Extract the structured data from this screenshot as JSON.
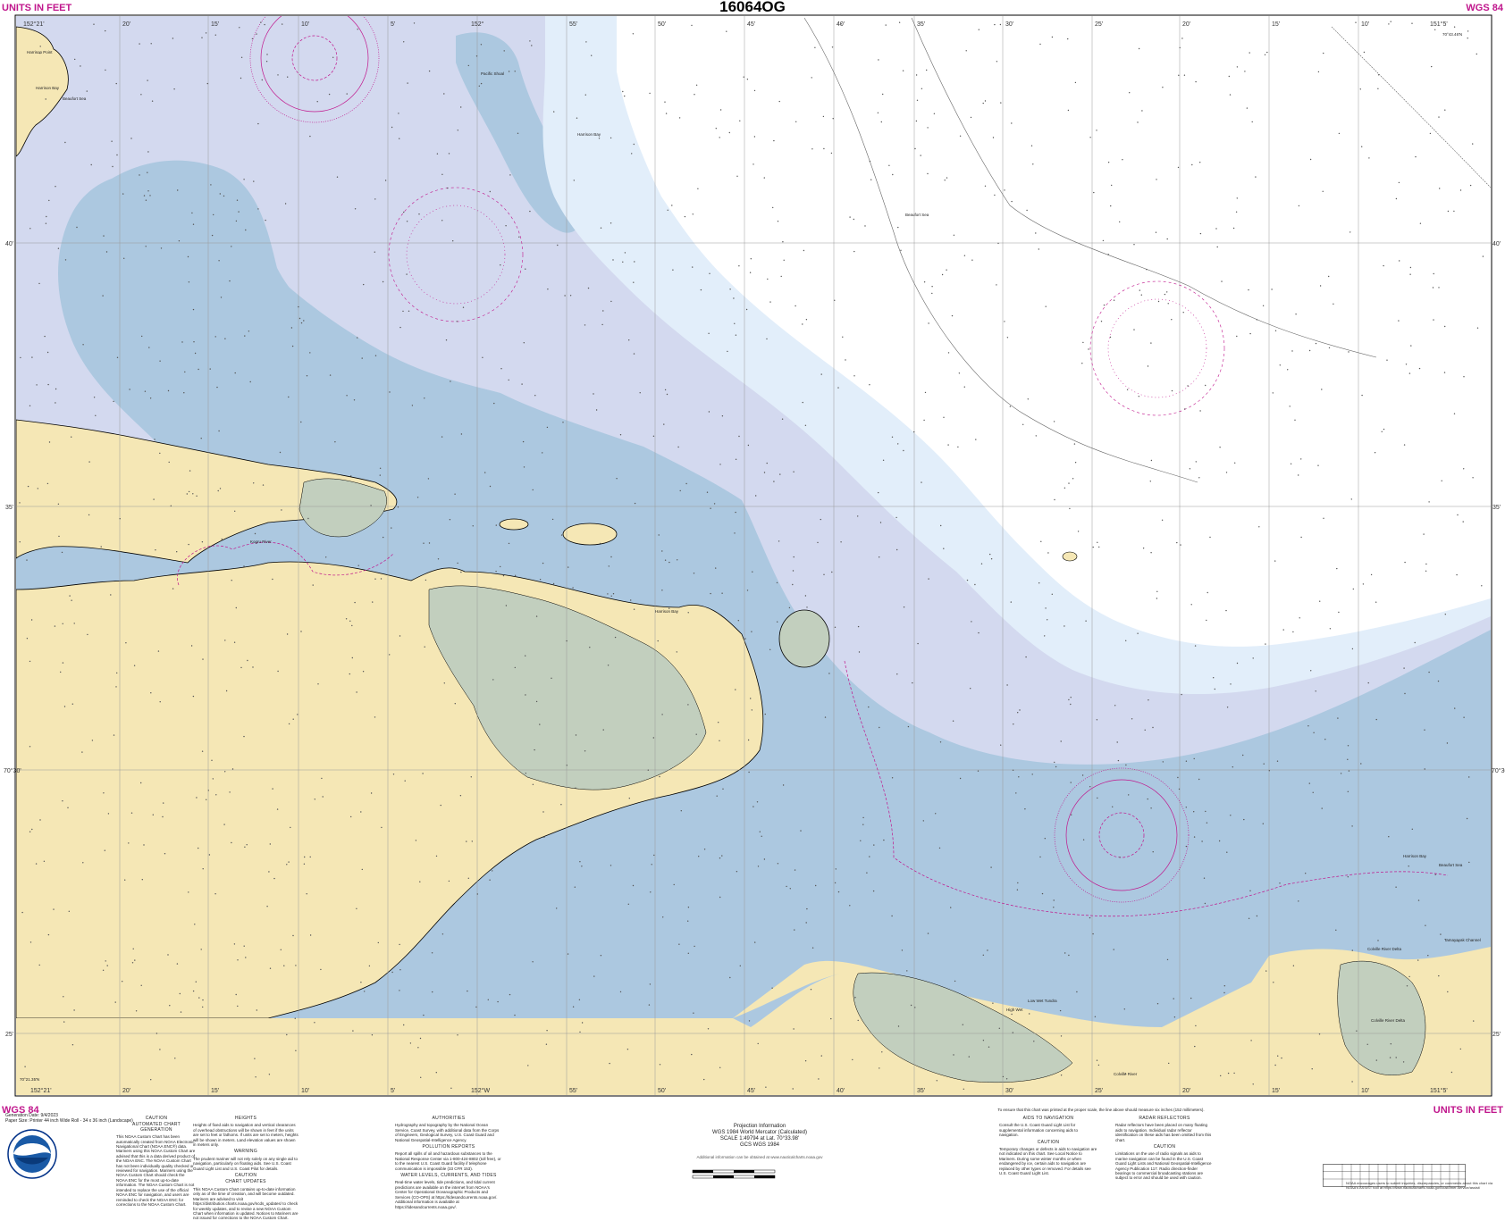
{
  "header": {
    "chart_number": "16064OG",
    "units_left": "UNITS IN FEET",
    "datum_right": "WGS 84"
  },
  "footer": {
    "datum_left": "WGS 84",
    "units_right": "UNITS IN FEET",
    "generation_label": "Generation Date: 9/4/2023",
    "paper_size": "Paper Size: Printer 44 inch Wide Roll - 34 x 36 inch (Landscape)"
  },
  "graticule": {
    "top_labels": [
      "152°21'",
      "20'",
      "15'",
      "10'",
      "5'",
      "152°",
      "55'",
      "50'",
      "45'",
      "40'",
      "35'",
      "30'",
      "25'",
      "20'",
      "15'",
      "10'",
      "151°5'"
    ],
    "bottom_labels": [
      "152°21'",
      "20'",
      "15'",
      "10'",
      "5'",
      "152°W",
      "55'",
      "50'",
      "45'",
      "40'",
      "35'",
      "30'",
      "25'",
      "20'",
      "15'",
      "10'",
      "151°5'"
    ],
    "left_labels": [
      "40'",
      "35'",
      "70°30'",
      "25'"
    ],
    "right_labels": [
      "40'",
      "35'",
      "70°30'",
      "25'"
    ],
    "corner_tr": "70°43.46'N",
    "corner_bl": "70°21.35'N"
  },
  "places": [
    {
      "name": "Harrison Point"
    },
    {
      "name": "Harrison Bay"
    },
    {
      "name": "Beaufort Sea"
    },
    {
      "name": "Pacific Shoal"
    },
    {
      "name": "Harrison Bay"
    },
    {
      "name": "Beaufort Sea"
    },
    {
      "name": "Kogru River"
    },
    {
      "name": "Harrison Bay"
    },
    {
      "name": "Harrison Bay"
    },
    {
      "name": "Beaufort Sea"
    },
    {
      "name": "Colville River Delta"
    },
    {
      "name": "Tamayayak Channel"
    },
    {
      "name": "Colville River Delta"
    },
    {
      "name": "Low Wet Tundra"
    },
    {
      "name": "Colville River"
    },
    {
      "name": "High Wet"
    }
  ],
  "notes": {
    "caution_auto": {
      "title": "CAUTION",
      "subtitle": "AUTOMATED CHART GENERATION",
      "text": "This NOAA Custom Chart has been automatically created from NOAA Electronic Navigational Chart (NOAA ENC®) data. Mariners using this NOAA Custom Chart are advised that this is a data derived product of the NOAA ENC. The NOAA Custom Chart has not been individually quality checked or reviewed for navigation. Mariners using the NOAA Custom Chart should check the NOAA ENC for the most up-to-date information. The NOAA Custom Chart is not intended to replace the use of the official NOAA ENC for navigation, and users are reminded to check the NOAA ENC for corrections to the NOAA Custom Chart."
    },
    "heights": {
      "title": "HEIGHTS",
      "text": "Heights of fixed aids to navigation and vertical clearances of overhead obstructions will be shown in feet if the units are set to feet or fathoms. If units are set to meters, heights will be shown in meters. Land elevation values are shown in meters only."
    },
    "warning": {
      "title": "WARNING",
      "text": "The prudent mariner will not rely solely on any single aid to navigation, particularly on floating aids. See U.S. Coast Guard Light List and U.S. Coast Pilot for details."
    },
    "caution_updates": {
      "title": "CAUTION",
      "subtitle": "CHART UPDATES",
      "text": "This NOAA Custom Chart contains up-to-date information only as of the time of creation, and will become outdated. Mariners are advised to visit https://distribution.charts.noaa.gov/ncds_updates/ to check for weekly updates, and to revise a new NOAA Custom Chart when information is updated. Notices to Mariners are not issued for corrections to the NOAA Custom Chart."
    },
    "authorities": {
      "title": "AUTHORITIES",
      "text": "Hydrography and topography by the National Ocean Service, Coast Survey, with additional data from the Corps of Engineers, Geological Survey, U.S. Coast Guard and National Geospatial-Intelligence Agency."
    },
    "pollution": {
      "title": "POLLUTION REPORTS",
      "text": "Report all spills of oil and hazardous substances to the National Response Center via 1-800-424-8802 (toll free), or to the nearest U.S. Coast Guard facility if telephone communication is impossible (33 CFR 153)."
    },
    "water_levels": {
      "title": "WATER LEVELS, CURRENTS, AND TIDES",
      "text": "Real-time water levels, tide predictions, and tidal current predictions are available on the internet from NOAA's Center for Operational Oceanographic Products and Services (CO-OPS) at https://tidesandcurrents.noaa.gov/. Additional information is available at https://tidesandcurrents.noaa.gov/."
    },
    "aids": {
      "title": "AIDS TO NAVIGATION",
      "text": "Consult the U.S. Coast Guard Light List for supplemental information concerning aids to navigation."
    },
    "caution_aids": {
      "title": "CAUTION",
      "text": "Temporary changes or defects in aids to navigation are not indicated on this chart. See Local Notice to Mariners. During some winter months or when endangered by ice, certain aids to navigation are replaced by other types or removed. For details see U.S. Coast Guard Light List."
    },
    "radar": {
      "title": "RADAR REFLECTORS",
      "text": "Radar reflectors have been placed on many floating aids to navigation. Individual radar reflector identification on these aids has been omitted from this chart."
    },
    "caution_radio": {
      "title": "CAUTION",
      "text": "Limitations on the use of radio signals as aids to marine navigation can be found in the U.S. Coast Guard Light Lists and National Geospatial-Intelligence Agency Publication 117. Radio direction-finder bearings to commercial broadcasting stations are subject to error and should be used with caution."
    }
  },
  "projection": {
    "title": "Projection Information",
    "line1": "WGS 1984 World Mercator (Calculated)",
    "line2": "SCALE 1:49794 at Lat. 70°33.98'",
    "line3": "GCS WGS 1984",
    "info": "Additional information can be obtained at www.nauticalcharts.noaa.gov"
  },
  "scale_note": "To ensure that this chart was printed at the proper scale, the line above should measure six inches (152 millimeters).",
  "table_note": "NOAA encourages users to submit inquiries, discrepancies, or comments about this chart via NOAA's ASSIST tool at https://www.nauticalcharts.noaa.gov/customer-service/assist/",
  "colors": {
    "land": "#f5e7b5",
    "marsh": "#c2cfbe",
    "deep_blue": "#acc8e0",
    "mid_blue": "#c6d5ec",
    "lavender": "#d3d9ef",
    "pale_blue": "#e2eefa",
    "deep_water": "#ffffff",
    "magenta": "#c0168c"
  }
}
